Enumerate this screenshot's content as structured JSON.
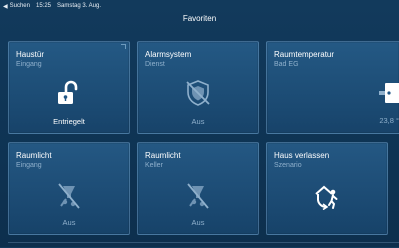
{
  "status_bar": {
    "back_label": "Suchen",
    "time": "15:25",
    "date": "Samstag 3. Aug."
  },
  "header": {
    "title": "Favoriten"
  },
  "tiles": [
    {
      "title": "Haustür",
      "subtitle": "Eingang",
      "status": "Entriegelt",
      "icon": "unlocked-padlock-icon"
    },
    {
      "title": "Alarmsystem",
      "subtitle": "Dienst",
      "status": "Aus",
      "icon": "shield-off-icon"
    },
    {
      "title": "Raumtemperatur",
      "subtitle": "Bad EG",
      "status": "23,8 °",
      "icon": "thermostat-icon"
    },
    {
      "title": "Raumlicht",
      "subtitle": "Eingang",
      "status": "Aus",
      "icon": "light-off-icon"
    },
    {
      "title": "Raumlicht",
      "subtitle": "Keller",
      "status": "Aus",
      "icon": "light-off-icon"
    },
    {
      "title": "Haus verlassen",
      "subtitle": "Szenario",
      "status": "",
      "icon": "leave-house-icon"
    }
  ],
  "colors": {
    "accent": "#ffffff",
    "muted_text": "#8fb0cc",
    "background": "#123a5c"
  }
}
